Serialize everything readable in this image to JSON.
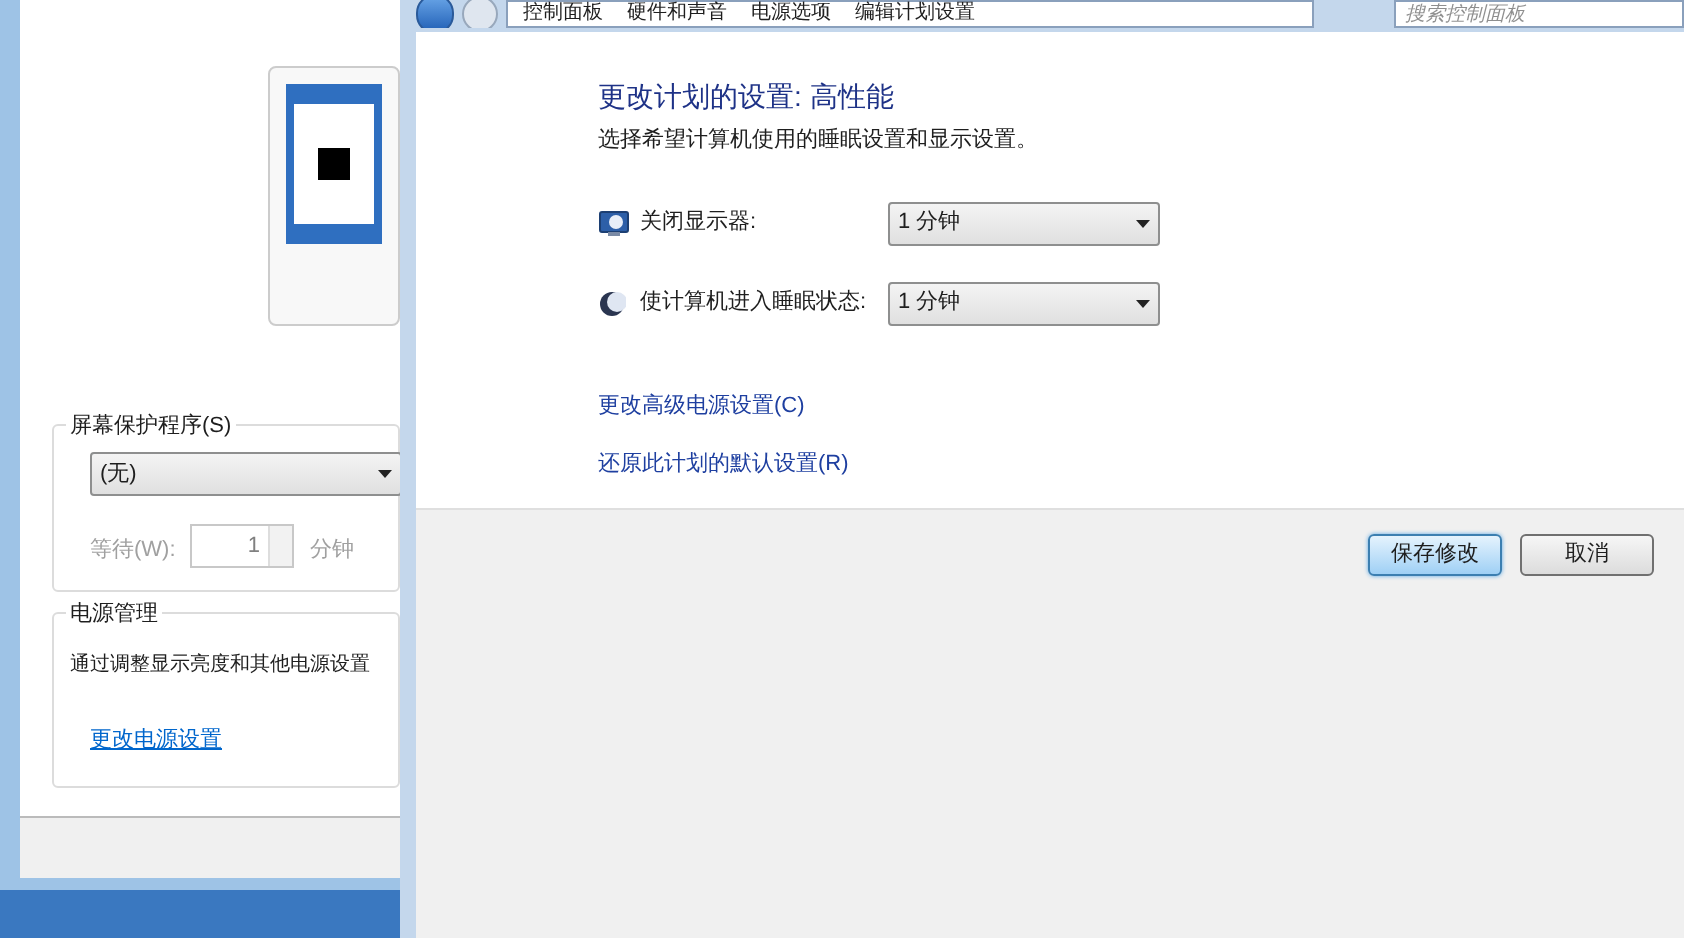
{
  "background_window": {
    "screensaver": {
      "title": "屏幕保护程序(S)",
      "value": "(无)",
      "wait_label": "等待(W):",
      "wait_value": "1",
      "unit": "分钟",
      "disabled": true
    },
    "power": {
      "title": "电源管理",
      "description": "通过调整显示亮度和其他电源设置",
      "link": "更改电源设置"
    }
  },
  "window": {
    "breadcrumb": [
      "控制面板",
      "硬件和声音",
      "电源选项",
      "编辑计划设置"
    ],
    "search": {
      "placeholder": "搜索控制面板"
    },
    "heading": "更改计划的设置: 高性能",
    "subtitle": "选择希望计算机使用的睡眠设置和显示设置。",
    "settings": [
      {
        "kind": "display",
        "label": "关闭显示器:",
        "value": "1 分钟"
      },
      {
        "kind": "sleep",
        "label": "使计算机进入睡眠状态:",
        "value": "1 分钟"
      }
    ],
    "links": [
      "更改高级电源设置(C)",
      "还原此计划的默认设置(R)"
    ],
    "buttons": [
      {
        "kind": "primary",
        "label": "保存修改"
      },
      {
        "kind": "default",
        "label": "取消"
      }
    ]
  }
}
